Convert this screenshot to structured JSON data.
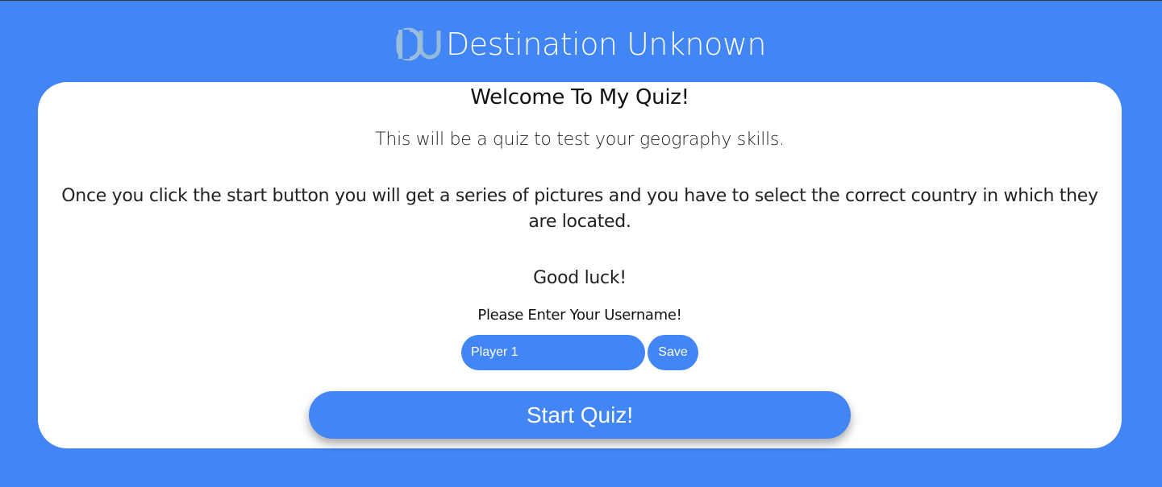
{
  "header": {
    "logo_letters": "DU",
    "title": "Destination Unknown"
  },
  "card": {
    "heading": "Welcome To My Quiz!",
    "intro": "This will be a quiz to test your geography skills.",
    "instructions": "Once you click the start button you will get a series of pictures and you have to select the correct country in which they are located.",
    "good_luck": "Good luck!",
    "username_label": "Please Enter Your Username!",
    "username_value": "Player 1",
    "save_label": "Save",
    "start_label": "Start Quiz!"
  },
  "colors": {
    "background": "#4285f4",
    "card": "#ffffff",
    "button": "#4285f4"
  }
}
